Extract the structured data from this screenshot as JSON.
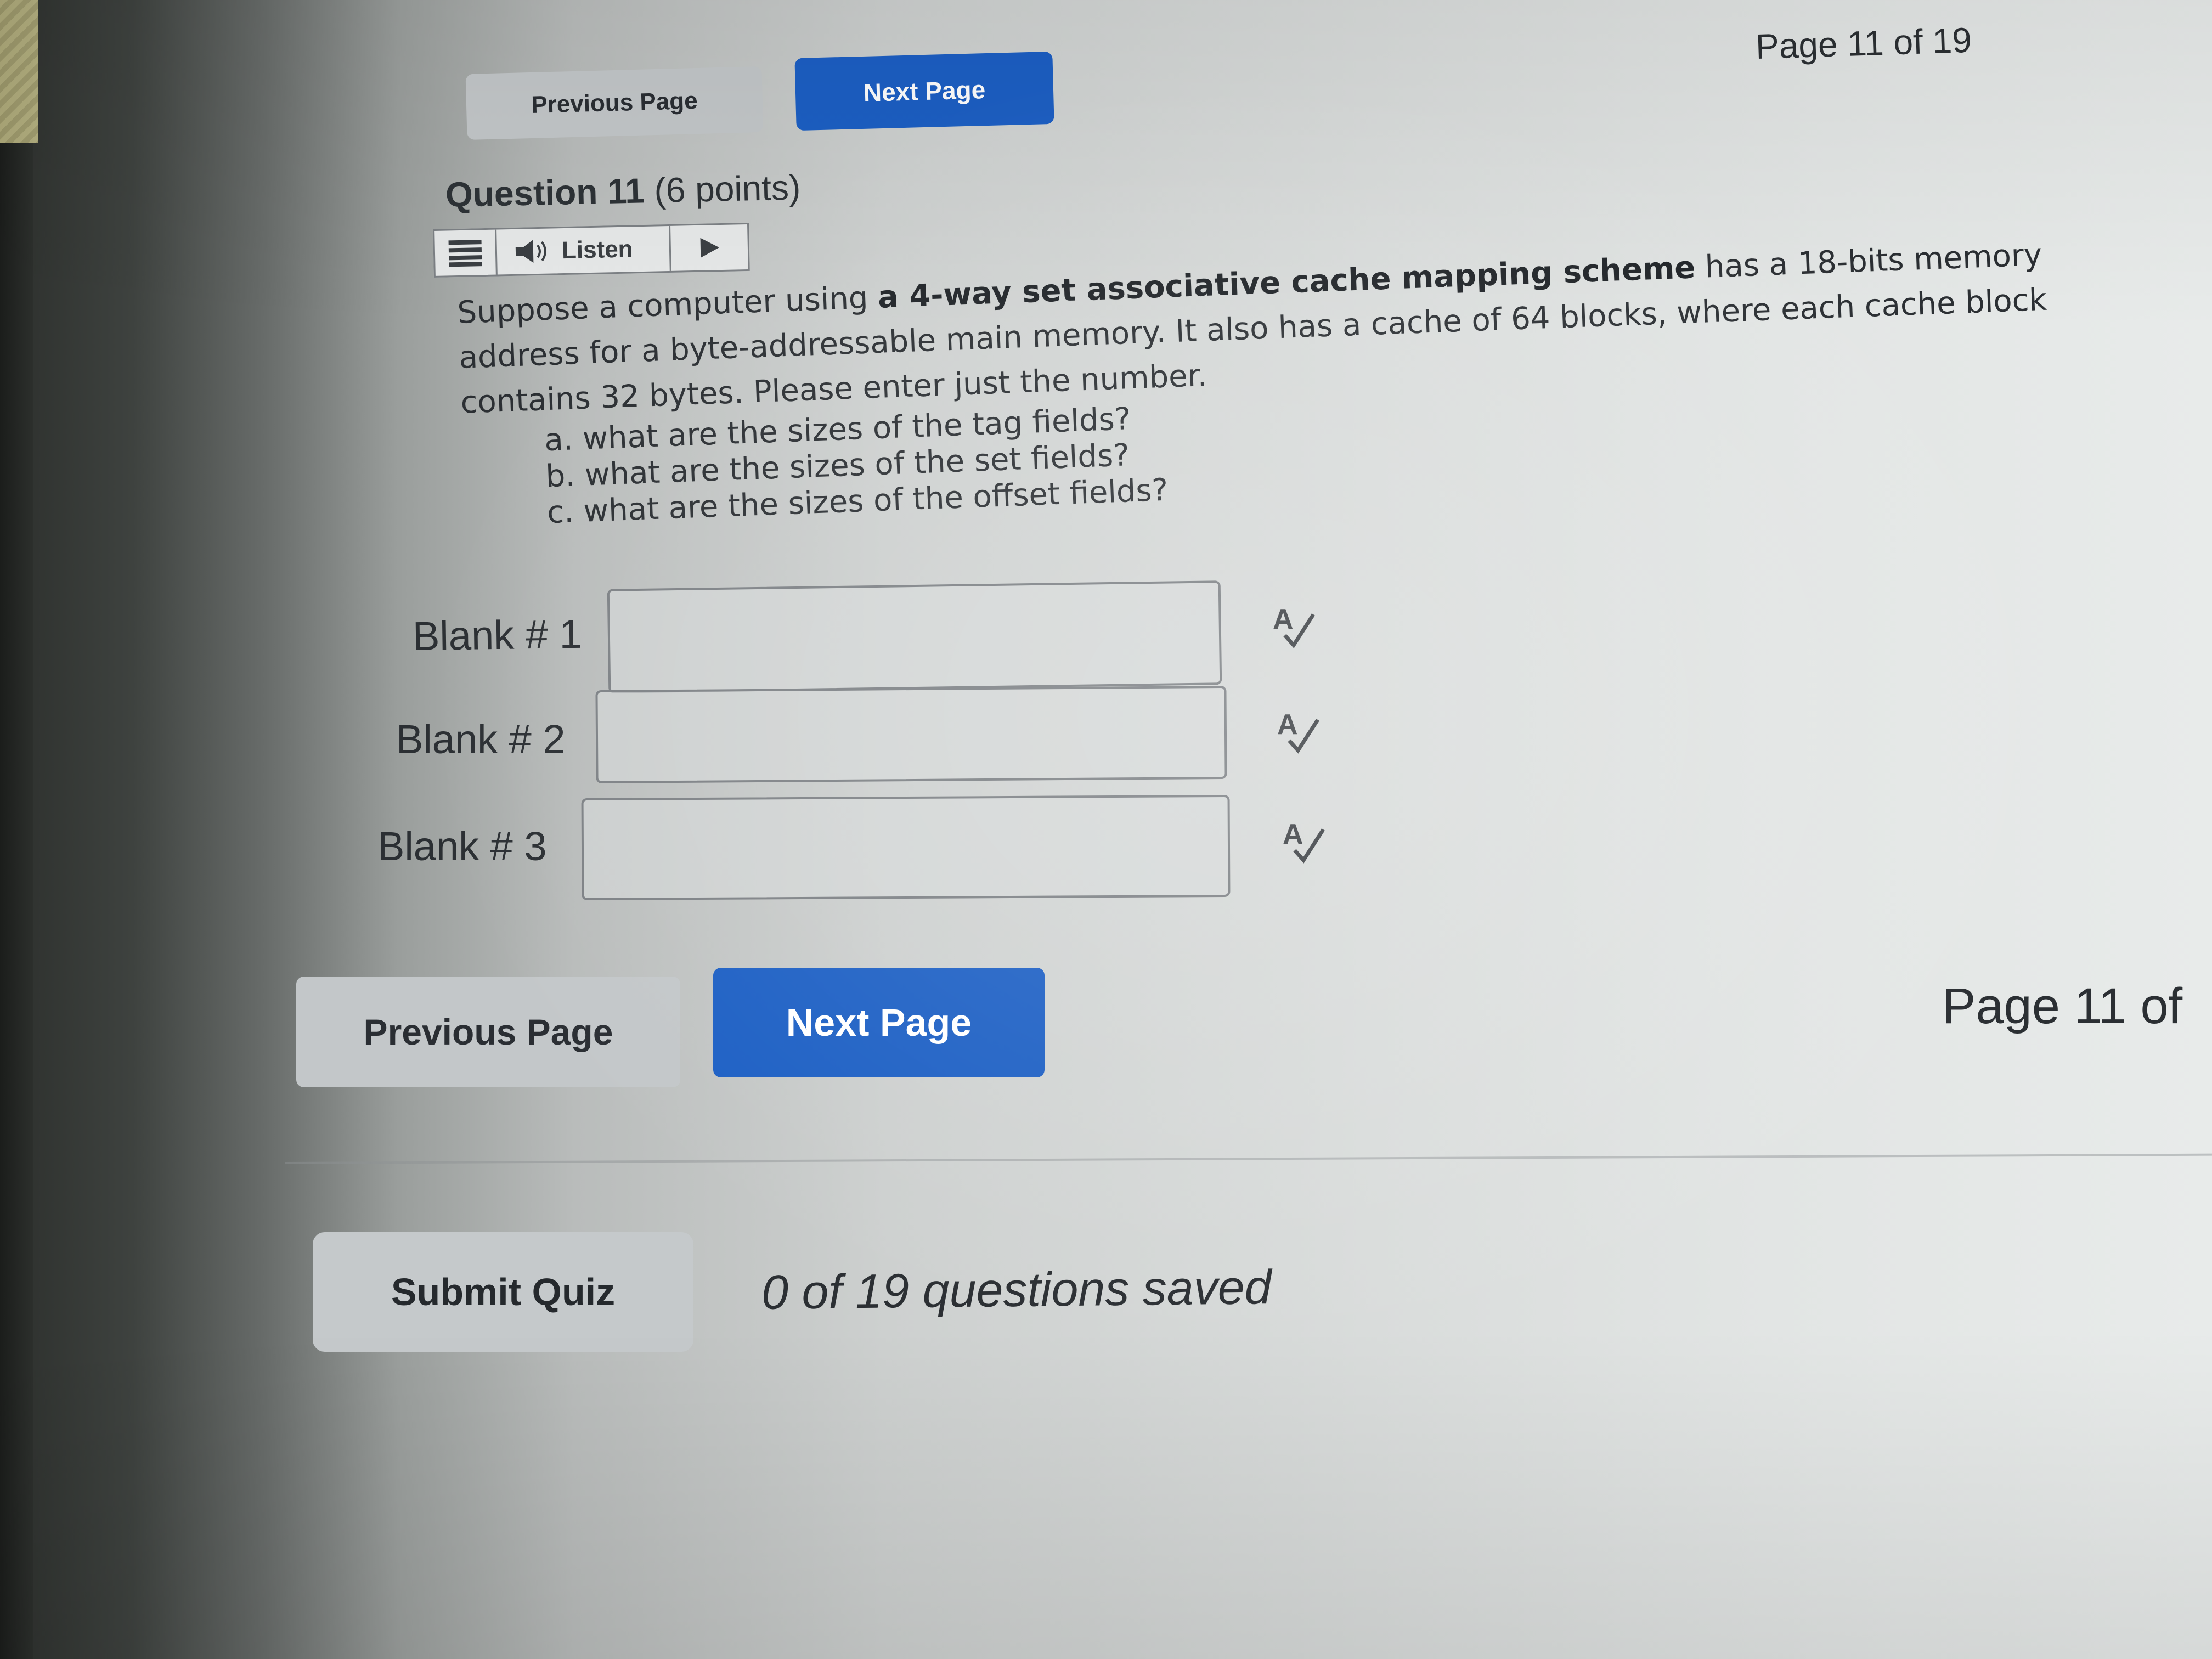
{
  "nav_top": {
    "previous_label": "Previous Page",
    "next_label": "Next Page",
    "page_indicator": "Page 11 of 19"
  },
  "question": {
    "number_label": "Question 11",
    "points_label": "(6 points)",
    "listen": {
      "label": "Listen",
      "icons": [
        "menu-icon",
        "speaker-icon",
        "play-icon"
      ]
    },
    "body": {
      "intro": "Suppose a computer using ",
      "bold_scheme": "a 4-way set associative cache mapping scheme",
      "after_bold": " has a 18-bits memory address for a byte-addressable main memory.  It also has a cache of 64 blocks, where each cache block contains 32 bytes. Please enter just the number."
    },
    "items": [
      "a. what are the sizes of the tag fields?",
      "b. what are the sizes of the set fields?",
      "c. what are the sizes of the offset fields?"
    ]
  },
  "blanks": [
    {
      "label": "Blank # 1",
      "value": "",
      "placeholder": ""
    },
    {
      "label": "Blank # 2",
      "value": "",
      "placeholder": ""
    },
    {
      "label": "Blank # 3",
      "value": "",
      "placeholder": ""
    }
  ],
  "spellcheck_icon": "spellcheck-icon",
  "nav_bottom": {
    "previous_label": "Previous Page",
    "next_label": "Next Page",
    "page_indicator": "Page 11 of"
  },
  "footer": {
    "submit_label": "Submit Quiz",
    "saved_status": "0 of 19 questions saved"
  },
  "colors": {
    "next_button": "#1c5fc4",
    "secondary_button": "#c3c7c9",
    "text": "#2b2f33"
  }
}
